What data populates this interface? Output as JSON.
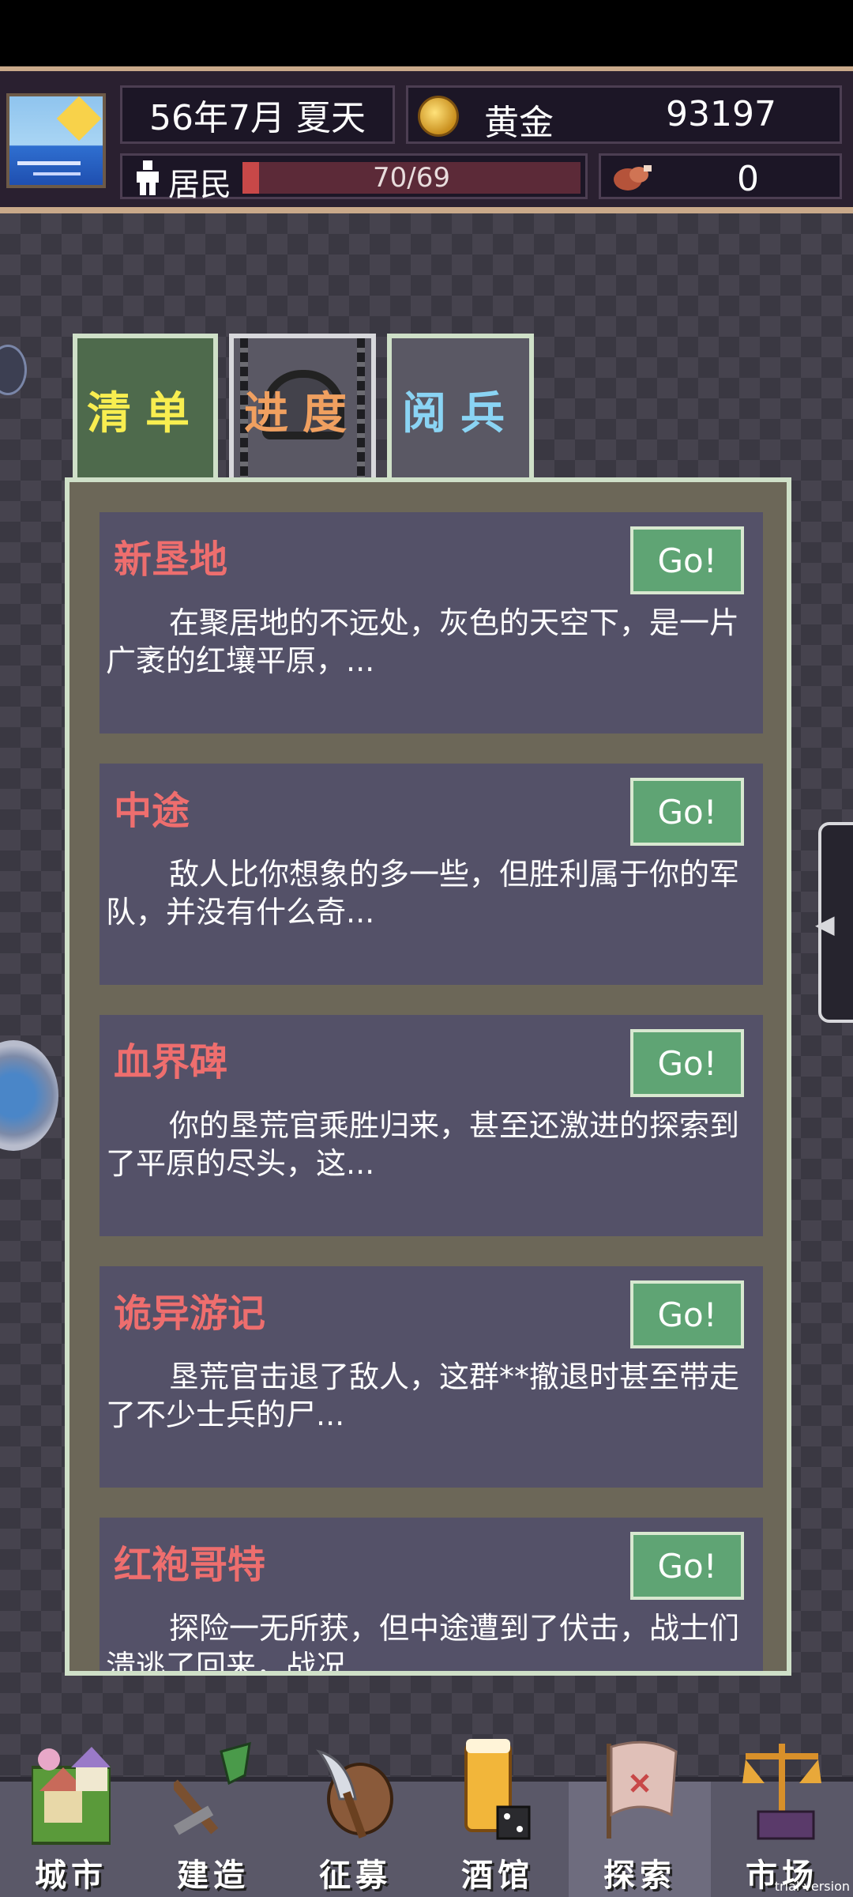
{
  "header": {
    "date": "56年7月 夏天",
    "gold_label": "黄金",
    "gold_value": "93197",
    "residents_label": "居民",
    "residents_value": "70/69",
    "residents_fill": 0.05,
    "meat_value": "0"
  },
  "tabs": [
    {
      "label": "清单"
    },
    {
      "label": "进度"
    },
    {
      "label": "阅兵"
    }
  ],
  "quests": [
    {
      "title": "新垦地",
      "go": "Go!",
      "desc": "在聚居地的不远处，灰色的天空下，是一片广袤的红壤平原，..."
    },
    {
      "title": "中途",
      "go": "Go!",
      "desc": "敌人比你想象的多一些，但胜利属于你的军队，并没有什么奇..."
    },
    {
      "title": "血界碑",
      "go": "Go!",
      "desc": "你的垦荒官乘胜归来，甚至还激进的探索到了平原的尽头，这..."
    },
    {
      "title": "诡异游记",
      "go": "Go!",
      "desc": "垦荒官击退了敌人，这群**撤退时甚至带走了不少士兵的尸..."
    },
    {
      "title": "红袍哥特",
      "go": "Go!",
      "desc": "探险一无所获，但中途遭到了伏击，战士们溃逃了回来，战况..."
    }
  ],
  "nav": [
    {
      "label": "城市",
      "icon": "city-icon"
    },
    {
      "label": "建造",
      "icon": "shovel-icon"
    },
    {
      "label": "征募",
      "icon": "axe-shield-icon"
    },
    {
      "label": "酒馆",
      "icon": "beer-dice-icon"
    },
    {
      "label": "探索",
      "icon": "map-flag-icon"
    },
    {
      "label": "市场",
      "icon": "scales-icon"
    }
  ],
  "trial_text": "trial version"
}
